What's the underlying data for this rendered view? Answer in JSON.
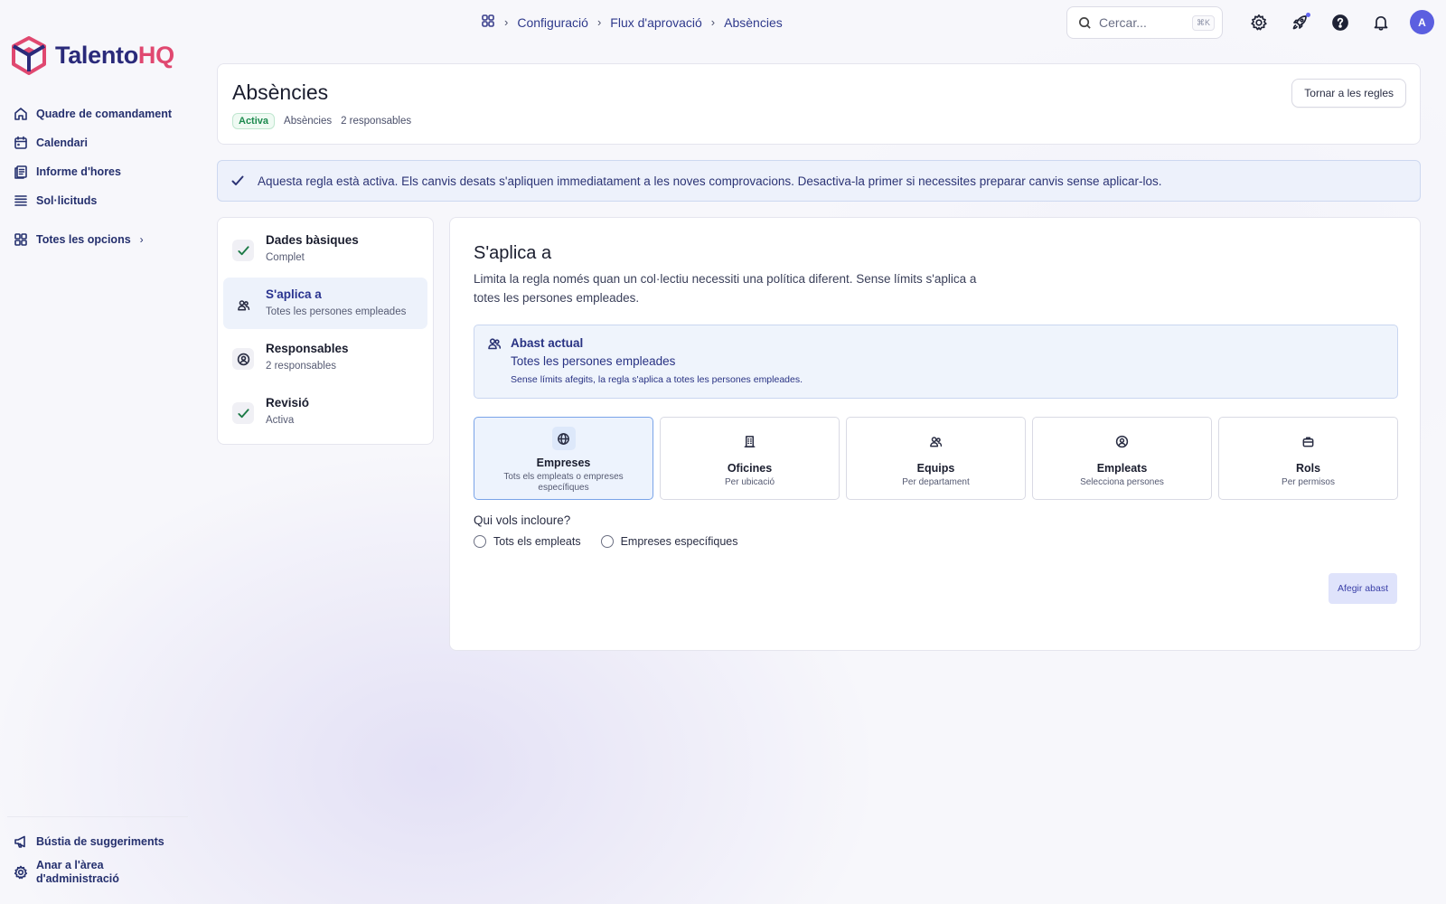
{
  "app": {
    "brand": "TalentoHQ",
    "brand_part1": "Talento",
    "brand_part2": "HQ"
  },
  "sidebar": {
    "items": [
      {
        "label": "Quadre de comandament",
        "icon": "home-icon"
      },
      {
        "label": "Calendari",
        "icon": "calendar-icon"
      },
      {
        "label": "Informe d'hores",
        "icon": "report-icon"
      },
      {
        "label": "Sol·licituds",
        "icon": "list-icon"
      }
    ],
    "all_options": "Totes les opcions",
    "all_options_chevron": "›",
    "feedback": "Bústia de suggeriments",
    "admin_line1": "Anar a l'àrea",
    "admin_line2": "d'administració"
  },
  "breadcrumb": {
    "items": [
      "Configuració",
      "Flux d'aprovació",
      "Absències"
    ],
    "sep": "›"
  },
  "search": {
    "placeholder": "Cercar...",
    "shortcut": "⌘K"
  },
  "user": {
    "initial": "A"
  },
  "header": {
    "title": "Absències",
    "status": "Activa",
    "type": "Absències",
    "approvers": "2 responsables",
    "back_button": "Tornar a les regles"
  },
  "banner": {
    "text": "Aquesta regla està activa. Els canvis desats s'apliquen immediatament a les noves comprovacions. Desactiva-la primer si necessites preparar canvis sense aplicar-los."
  },
  "steps": [
    {
      "title": "Dades bàsiques",
      "subtitle": "Complet",
      "icon": "check-icon"
    },
    {
      "title": "S'aplica a",
      "subtitle": "Totes les persones empleades",
      "icon": "users-icon"
    },
    {
      "title": "Responsables",
      "subtitle": "2 responsables",
      "icon": "user-circle-icon"
    },
    {
      "title": "Revisió",
      "subtitle": "Activa",
      "icon": "check-icon"
    }
  ],
  "main": {
    "title": "S'aplica a",
    "description": "Limita la regla només quan un col·lectiu necessiti una política diferent. Sense límits s'aplica a totes les persones empleades.",
    "scope": {
      "title": "Abast actual",
      "value": "Totes les persones empleades",
      "note": "Sense límits afegits, la regla s'aplica a totes les persones empleades."
    },
    "options": [
      {
        "title": "Empreses",
        "subtitle": "Tots els empleats o empreses específiques",
        "icon": "globe-icon",
        "selected": true
      },
      {
        "title": "Oficines",
        "subtitle": "Per ubicació",
        "icon": "building-icon",
        "selected": false
      },
      {
        "title": "Equips",
        "subtitle": "Per departament",
        "icon": "users-icon",
        "selected": false
      },
      {
        "title": "Empleats",
        "subtitle": "Selecciona persones",
        "icon": "user-circle-icon",
        "selected": false
      },
      {
        "title": "Rols",
        "subtitle": "Per permisos",
        "icon": "briefcase-icon",
        "selected": false
      }
    ],
    "question": "Qui vols incloure?",
    "radio_all": "Tots els empleats",
    "radio_specific": "Empreses específiques",
    "add_button": "Afegir abast"
  }
}
